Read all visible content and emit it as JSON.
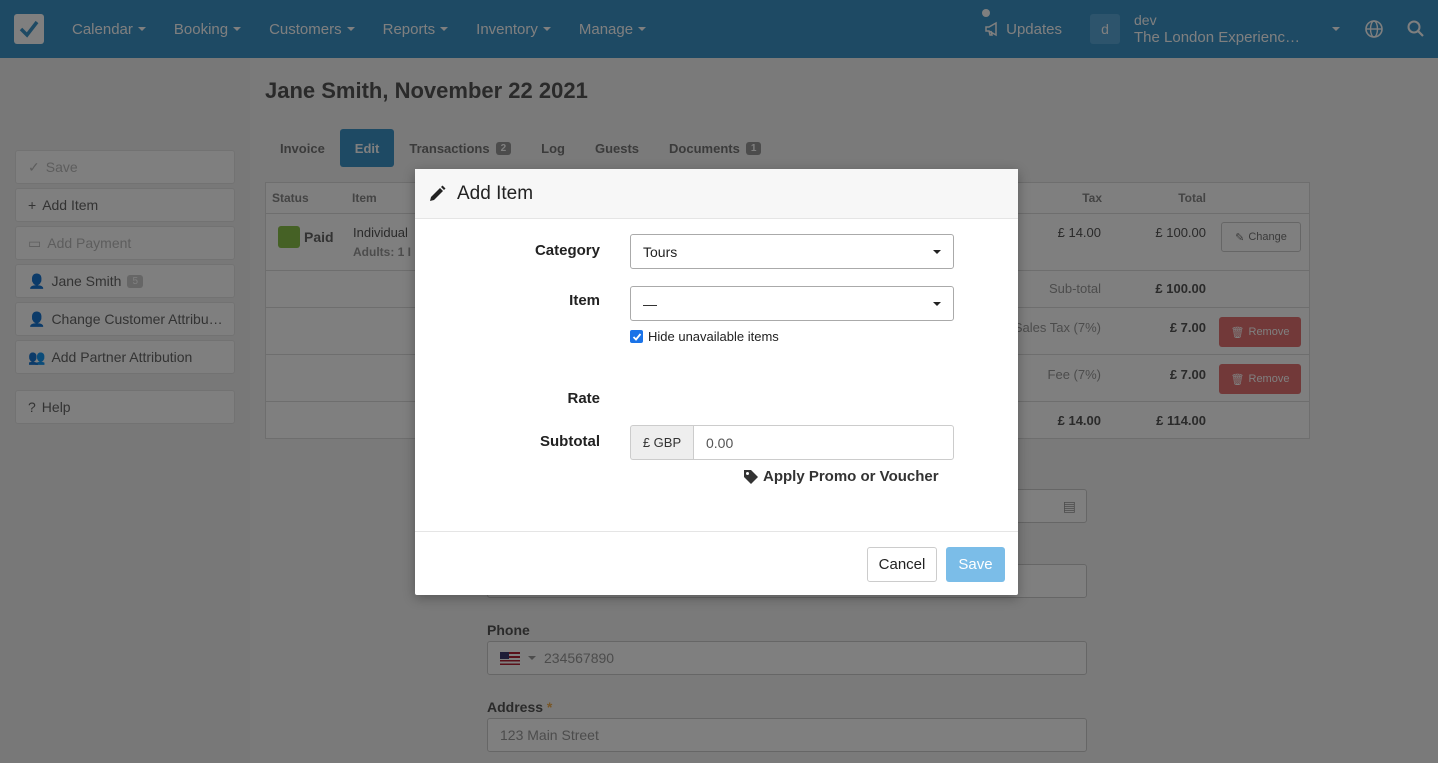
{
  "nav": {
    "items": [
      "Calendar",
      "Booking",
      "Customers",
      "Reports",
      "Inventory",
      "Manage"
    ],
    "updates_label": "Updates",
    "avatar_letter": "d",
    "user_name": "dev",
    "company": "The London Experienc…"
  },
  "sidebar": {
    "save_label": "Save",
    "add_item_label": "Add Item",
    "add_payment_label": "Add Payment",
    "customer_label": "Jane Smith",
    "customer_badge": "5",
    "change_attr_label": "Change Customer Attribu…",
    "partner_attr_label": "Add Partner Attribution",
    "help_label": "Help"
  },
  "page": {
    "title": "Jane Smith, November 22 2021",
    "tabs": [
      {
        "label": "Invoice",
        "badge": ""
      },
      {
        "label": "Edit",
        "badge": ""
      },
      {
        "label": "Transactions",
        "badge": "2"
      },
      {
        "label": "Log",
        "badge": ""
      },
      {
        "label": "Guests",
        "badge": ""
      },
      {
        "label": "Documents",
        "badge": "1"
      }
    ]
  },
  "table": {
    "headers": {
      "status": "Status",
      "item": "Item",
      "tax": "Tax",
      "total": "Total"
    },
    "row": {
      "status": "Paid",
      "item": "Individual",
      "item_sub": "Adults: 1 I",
      "tax": "£ 14.00",
      "total": "£ 100.00",
      "change_label": "Change"
    },
    "subtotal_label": "Sub-total",
    "subtotal_value": "£ 100.00",
    "sales_tax_label": "Sales Tax (7%)",
    "sales_tax_value": "£ 7.00",
    "fee_label": "Fee (7%)",
    "fee_value": "£ 7.00",
    "remove_label": "Remove",
    "total_tax": "£ 14.00",
    "grand_total": "£ 114.00"
  },
  "form": {
    "phone_label": "Phone",
    "phone_value": "234567890",
    "address_label": "Address",
    "address_required": "*",
    "address_value": "123 Main Street"
  },
  "modal": {
    "title": "Add Item",
    "category_label": "Category",
    "category_value": "Tours",
    "item_label": "Item",
    "item_value": "—",
    "hide_unavailable_label": "Hide unavailable items",
    "rate_label": "Rate",
    "subtotal_label": "Subtotal",
    "currency_addon": "£ GBP",
    "subtotal_value": "0.00",
    "promo_label": "Apply Promo or Voucher",
    "cancel_label": "Cancel",
    "save_label": "Save"
  },
  "colors": {
    "nav_bg": "#3d95c9",
    "accent": "#3d95c9",
    "paid": "#8bc34a",
    "remove": "#e57373",
    "save_button": "#7bbde8"
  }
}
